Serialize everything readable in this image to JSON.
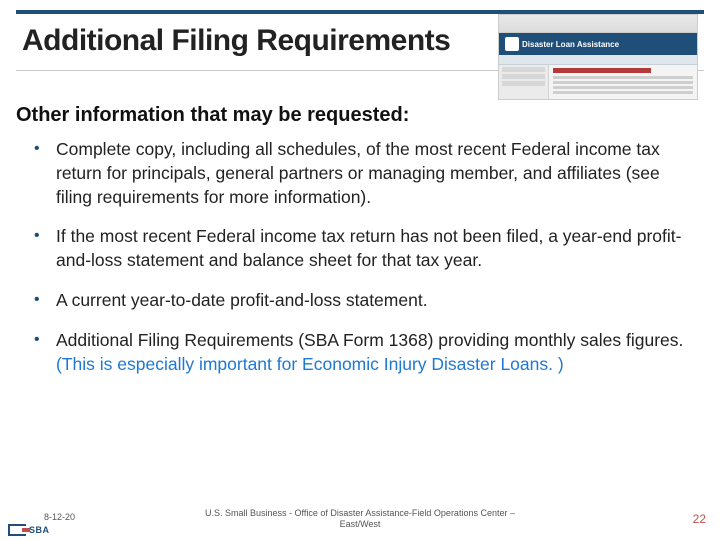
{
  "header": {
    "title": "Additional Filing Requirements",
    "thumbnail_banner": "Disaster Loan Assistance"
  },
  "subtitle": "Other information that may be requested:",
  "bullets": [
    {
      "text": "Complete copy, including all schedules, of the most recent Federal income tax return for principals, general partners or managing member, and affiliates (see filing requirements for more information)."
    },
    {
      "text": "If the most recent Federal income tax return has not been filed, a year-end profit-and-loss statement and balance sheet for that tax year."
    },
    {
      "text": "A current year-to-date profit-and-loss statement."
    },
    {
      "text": "Additional Filing Requirements (SBA Form 1368) providing monthly sales figures. ",
      "callout": "(This is especially important for Economic Injury Disaster Loans. )"
    }
  ],
  "footer": {
    "date": "8-12-20",
    "center_line1": "U.S. Small Business - Office of Disaster Assistance-Field Operations Center –",
    "center_line2": "East/West",
    "page": "22",
    "logo_text": "SBA"
  }
}
